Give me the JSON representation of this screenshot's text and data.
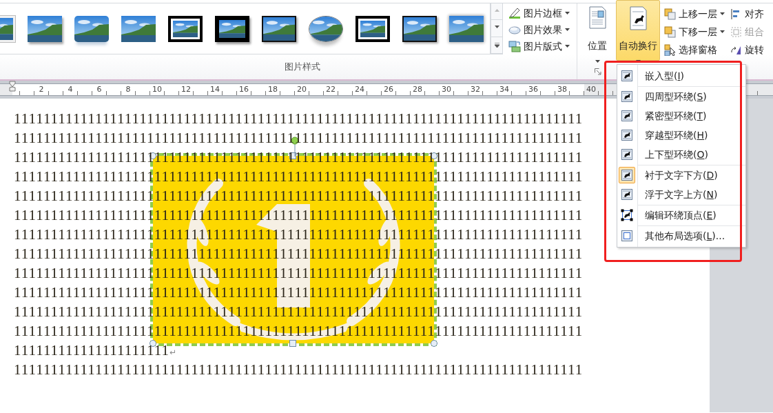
{
  "ribbon": {
    "picture_styles": {
      "gallery": [
        {
          "kind": "white-frame"
        },
        {
          "kind": "shadow"
        },
        {
          "kind": "reflected"
        },
        {
          "kind": "soft-edge"
        },
        {
          "kind": "double-black"
        },
        {
          "kind": "thick-black"
        },
        {
          "kind": "thin-black"
        },
        {
          "kind": "oval"
        },
        {
          "kind": "double-black"
        },
        {
          "kind": "thin-black"
        },
        {
          "kind": "glow"
        }
      ],
      "commands": [
        {
          "label": "图片边框",
          "dropdown": true
        },
        {
          "label": "图片效果",
          "dropdown": true
        },
        {
          "label": "图片版式",
          "dropdown": true
        }
      ],
      "group_label": "图片样式"
    },
    "arrange": {
      "large_buttons": [
        {
          "label": "位置",
          "pressed": false,
          "dropdown": true
        },
        {
          "label": "自动换行",
          "pressed": true,
          "dropdown": true
        }
      ],
      "order_commands": [
        {
          "label": "上移一层",
          "dropdown": true,
          "disabled": false
        },
        {
          "label": "下移一层",
          "dropdown": true,
          "disabled": false
        },
        {
          "label": "选择窗格",
          "dropdown": false,
          "disabled": false
        }
      ],
      "tool_commands": [
        {
          "label": "对齐",
          "disabled": false
        },
        {
          "label": "组合",
          "disabled": true
        },
        {
          "label": "旋转",
          "disabled": false
        }
      ]
    }
  },
  "ruler": {
    "labels": [
      "2",
      "4",
      "6",
      "8",
      "10",
      "12",
      "14",
      "16",
      "18",
      "20",
      "22",
      "24",
      "26",
      "28",
      "30",
      "32",
      "34",
      "36",
      "38",
      "40"
    ]
  },
  "document": {
    "lines": [
      {
        "text": "11111111111111111111111111111111111111111111111111111111111111111111111111111"
      },
      {
        "text": "11111111111111111111111111111111111111111111111111111111111111111111111111111"
      },
      {
        "text": "11111111111111111111111111111111111111111111111111111111111111111111111111111"
      },
      {
        "text": "11111111111111111111111111111111111111111111111111111111111111111111111111111"
      },
      {
        "text": "11111111111111111111111111111111111111111111111111111111111111111111111111111"
      },
      {
        "text": "11111111111111111111111111111111111111111111111111111111111111111111111111111"
      },
      {
        "text": "11111111111111111111111111111111111111111111111111111111111111111111111111111"
      },
      {
        "text": "11111111111111111111111111111111111111111111111111111111111111111111111111111"
      },
      {
        "text": "11111111111111111111111111111111111111111111111111111111111111111111111111111"
      },
      {
        "text": "11111111111111111111111111111111111111111111111111111111111111111111111111111"
      },
      {
        "text": "11111111111111111111111111111111111111111111111111111111111111111111111111111"
      },
      {
        "text": "11111111111111111111111111111111111111111111111111111111111111111111111111111"
      },
      {
        "text": "111111111111111111111",
        "paragraph_mark": "↵"
      },
      {
        "text": "11111111111111111111111111111111111111111111111111111111111111111111111111111"
      }
    ]
  },
  "wrap_menu": {
    "items": [
      {
        "kind": "wrap",
        "label": "嵌入型(",
        "accesskey": "I",
        "suffix": ")",
        "selected": false,
        "separator_after": true
      },
      {
        "kind": "wrap",
        "label": "四周型环绕(",
        "accesskey": "S",
        "suffix": ")",
        "selected": false,
        "separator_after": false
      },
      {
        "kind": "wrap",
        "label": "紧密型环绕(",
        "accesskey": "T",
        "suffix": ")",
        "selected": false,
        "separator_after": false
      },
      {
        "kind": "wrap",
        "label": "穿越型环绕(",
        "accesskey": "H",
        "suffix": ")",
        "selected": false,
        "separator_after": false
      },
      {
        "kind": "wrap",
        "label": "上下型环绕(",
        "accesskey": "O",
        "suffix": ")",
        "selected": false,
        "separator_after": true
      },
      {
        "kind": "wrap",
        "label": "衬于文字下方(",
        "accesskey": "D",
        "suffix": ")",
        "selected": true,
        "separator_after": false
      },
      {
        "kind": "wrap",
        "label": "浮于文字上方(",
        "accesskey": "N",
        "suffix": ")",
        "selected": false,
        "separator_after": true
      },
      {
        "kind": "edit-points",
        "label": "编辑环绕顶点(",
        "accesskey": "E",
        "suffix": ")",
        "selected": false,
        "separator_after": true
      },
      {
        "kind": "layout",
        "label": "其他布局选项(",
        "accesskey": "L",
        "suffix": ")...",
        "selected": false,
        "separator_after": false
      }
    ]
  }
}
